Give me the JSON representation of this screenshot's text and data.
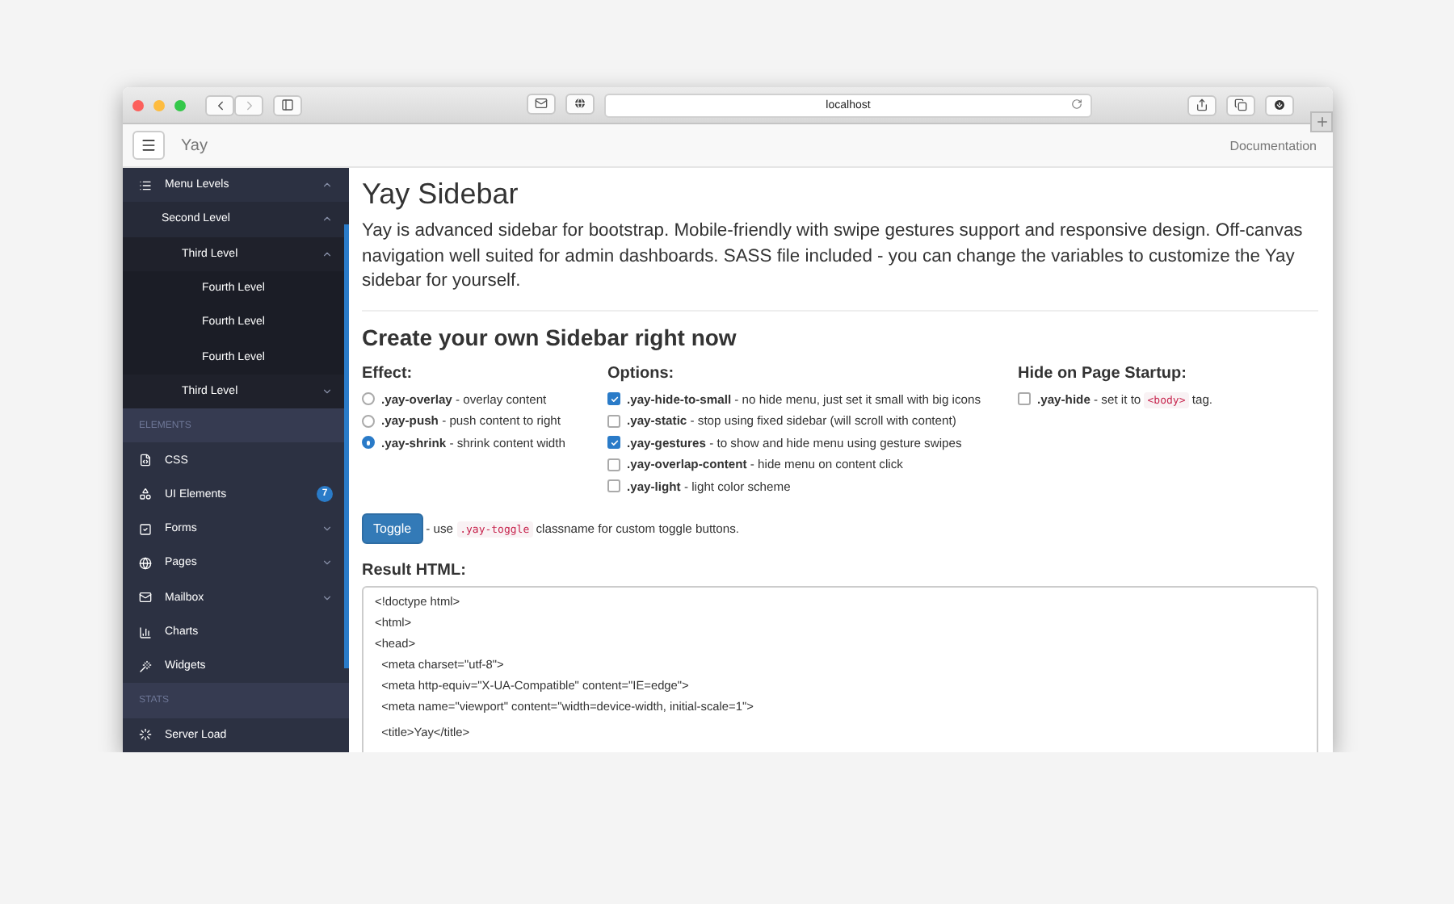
{
  "browser": {
    "url": "localhost"
  },
  "navbar": {
    "brand": "Yay",
    "link": "Documentation"
  },
  "sidebar": {
    "items": [
      {
        "kind": "item",
        "label": "Menu Levels",
        "expanded": true,
        "children": [
          {
            "label": "Second Level",
            "expanded": true,
            "children": [
              {
                "label": "Third Level",
                "expanded": true,
                "children": [
                  {
                    "label": "Fourth Level"
                  },
                  {
                    "label": "Fourth Level"
                  },
                  {
                    "label": "Fourth Level"
                  }
                ]
              },
              {
                "label": "Third Level",
                "expanded": false
              }
            ]
          }
        ]
      },
      {
        "kind": "header",
        "label": "ELEMENTS"
      },
      {
        "kind": "item",
        "label": "CSS"
      },
      {
        "kind": "item",
        "label": "UI Elements",
        "badge": "7"
      },
      {
        "kind": "item",
        "label": "Forms",
        "expanded": false
      },
      {
        "kind": "item",
        "label": "Pages",
        "expanded": false
      },
      {
        "kind": "item",
        "label": "Mailbox",
        "expanded": false
      },
      {
        "kind": "item",
        "label": "Charts"
      },
      {
        "kind": "item",
        "label": "Widgets"
      },
      {
        "kind": "header",
        "label": "STATS"
      },
      {
        "kind": "item",
        "label": "Server Load"
      }
    ]
  },
  "content": {
    "title": "Yay Sidebar",
    "intro": "Yay is advanced sidebar for bootstrap. Mobile-friendly with swipe gestures support and responsive design. Off-canvas navigation well suited for admin dashboards. SASS file included - you can change the variables to customize the Yay sidebar for yourself.",
    "heading": "Create your own Sidebar right now",
    "effect": {
      "title": "Effect:",
      "options": [
        {
          "name": ".yay-overlay",
          "desc": " - overlay content",
          "selected": false
        },
        {
          "name": ".yay-push",
          "desc": " - push content to right",
          "selected": false
        },
        {
          "name": ".yay-shrink",
          "desc": " - shrink content width",
          "selected": true
        }
      ]
    },
    "options": {
      "title": "Options:",
      "items": [
        {
          "name": ".yay-hide-to-small",
          "desc": " - no hide menu, just set it small with big icons",
          "checked": true
        },
        {
          "name": ".yay-static",
          "desc": " - stop using fixed sidebar (will scroll with content)",
          "checked": false
        },
        {
          "name": ".yay-gestures",
          "desc": " - to show and hide menu using gesture swipes",
          "checked": true
        },
        {
          "name": ".yay-overlap-content",
          "desc": " - hide menu on content click",
          "checked": false
        },
        {
          "name": ".yay-light",
          "desc": " - light color scheme",
          "checked": false
        }
      ]
    },
    "startup": {
      "title": "Hide on Page Startup:",
      "items": [
        {
          "name": ".yay-hide",
          "desc": " - set it to ",
          "tag": "<body>",
          "after": " tag.",
          "checked": false
        }
      ]
    },
    "toggle": {
      "button": "Toggle",
      "before": " - use ",
      "code": ".yay-toggle",
      "after": " classname for custom toggle buttons."
    },
    "result": {
      "title": "Result HTML:",
      "lines": [
        "<!doctype html>",
        "<html>",
        "<head>",
        "  <meta charset=\"utf-8\">",
        "  <meta http-equiv=\"X-UA-Compatible\" content=\"IE=edge\">",
        "  <meta name=\"viewport\" content=\"width=device-width, initial-scale=1\">"
      ],
      "after_gap": [
        "  <title>Yay</title>"
      ]
    }
  }
}
